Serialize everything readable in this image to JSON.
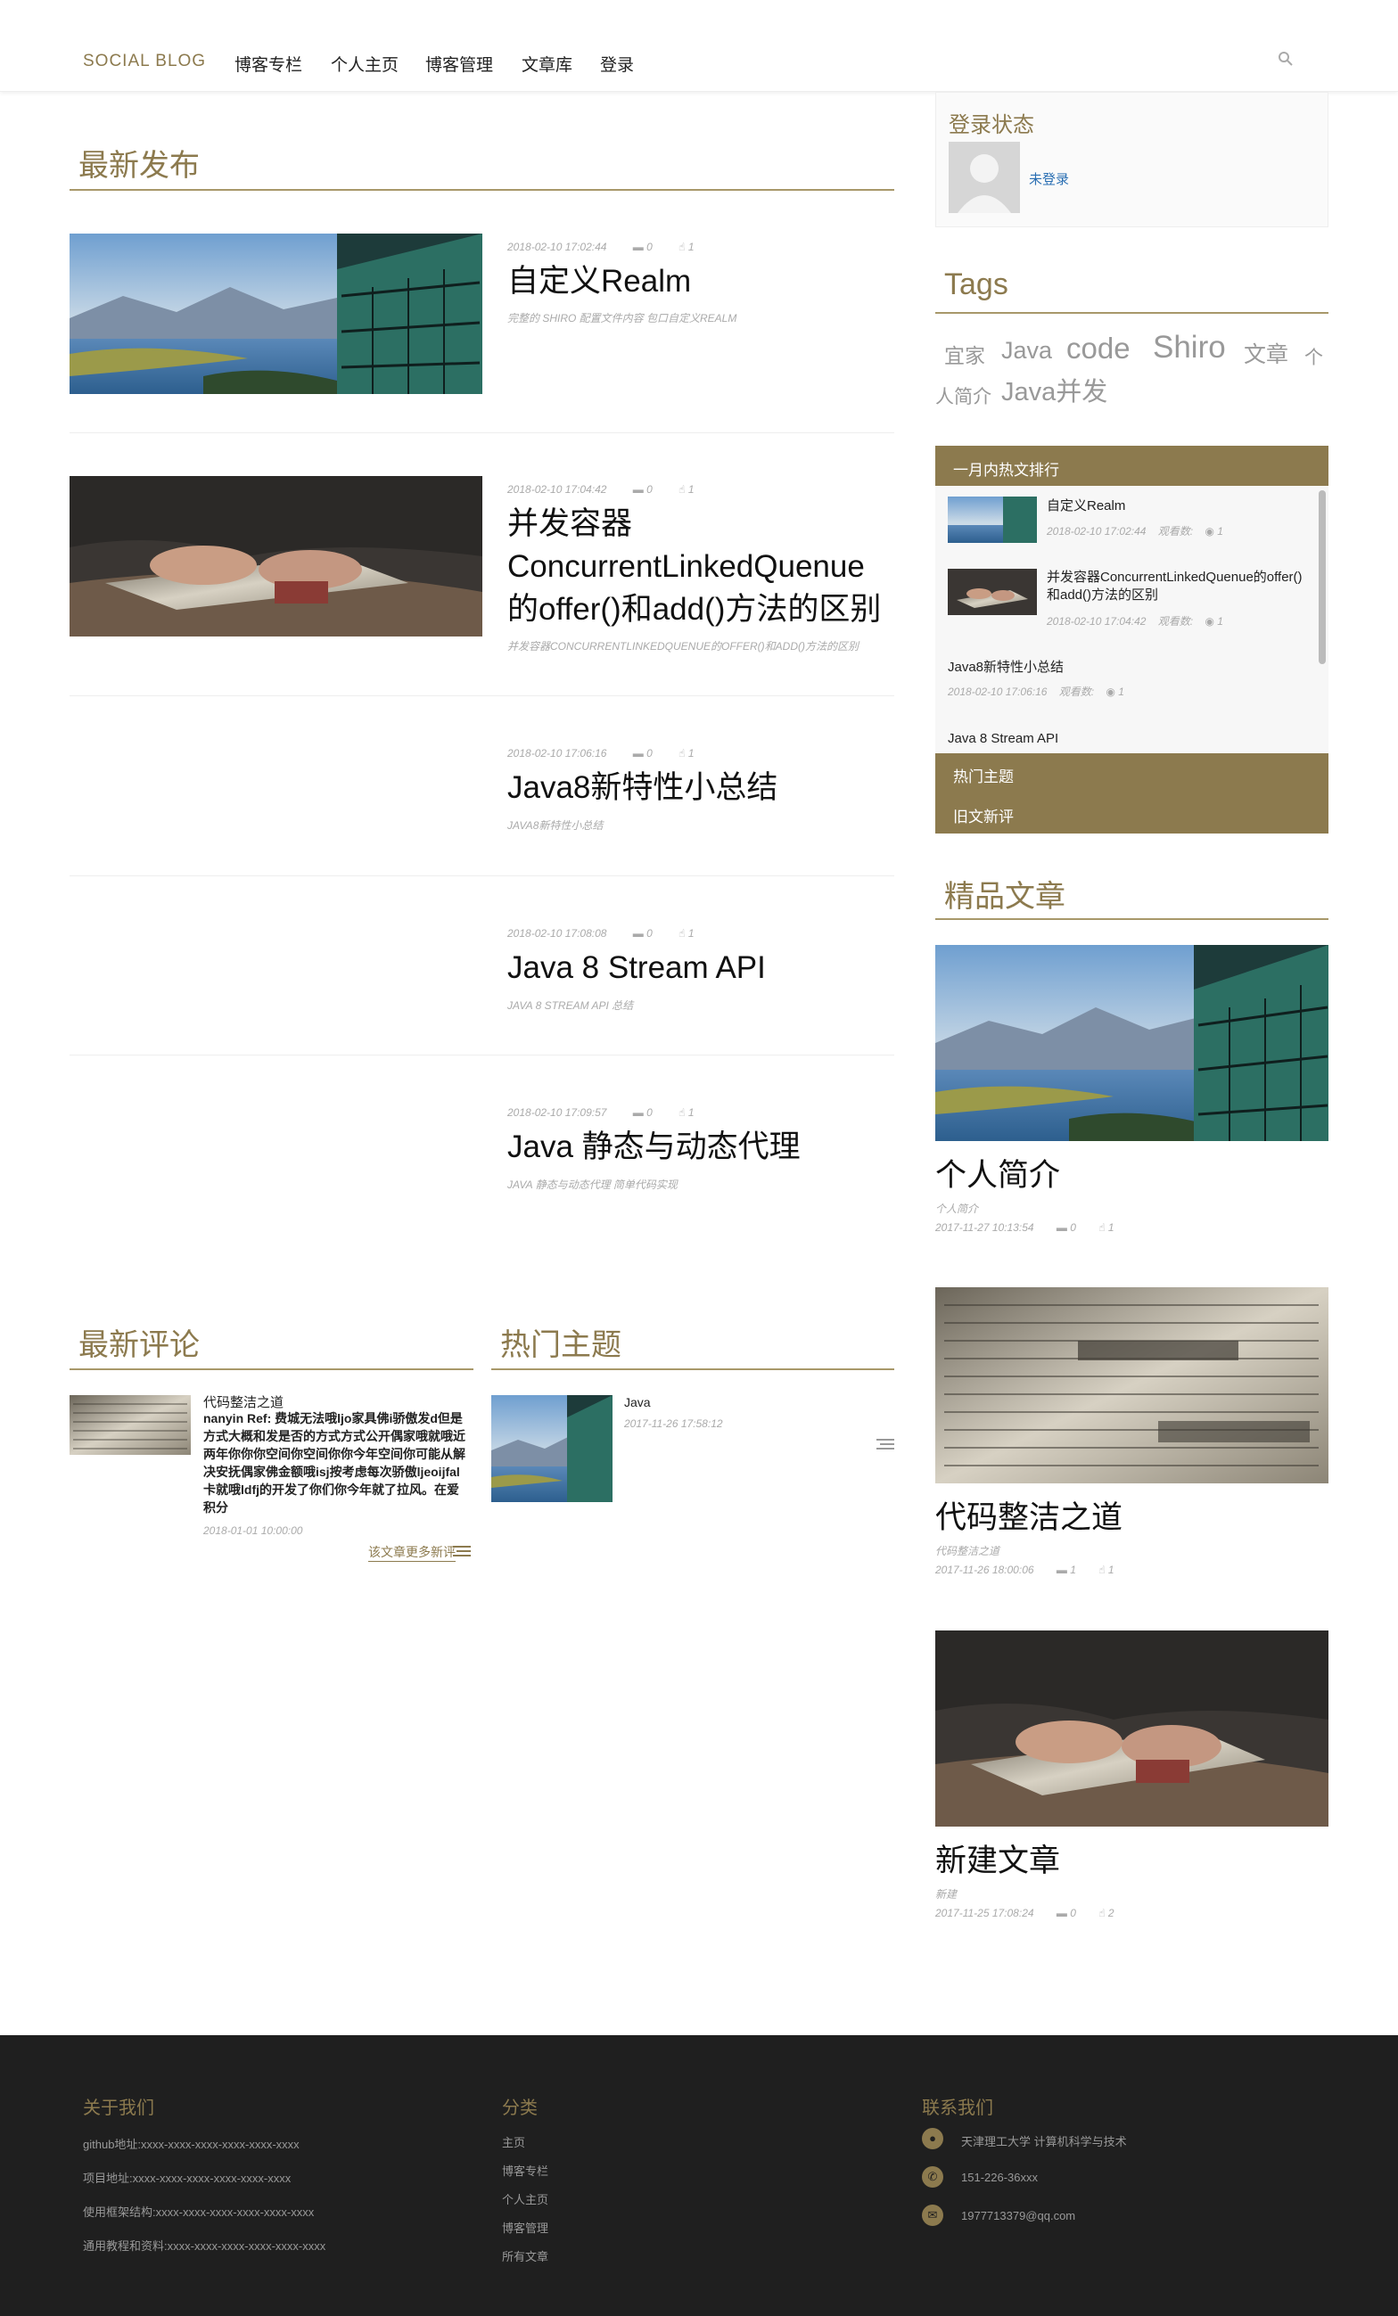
{
  "nav": {
    "brand": "SOCIAL BLOG",
    "items": [
      "博客专栏",
      "个人主页",
      "博客管理",
      "文章库",
      "登录"
    ],
    "search_icon": "search-icon"
  },
  "latest": {
    "heading": "最新发布",
    "posts": [
      {
        "date": "2018-02-10 17:02:44",
        "comments": "0",
        "likes": "1",
        "title": "自定义Realm",
        "summary": "完整的 SHIRO 配置文件内容 包口自定义REALM"
      },
      {
        "date": "2018-02-10 17:04:42",
        "comments": "0",
        "likes": "1",
        "title": "并发容器ConcurrentLinkedQuenue的offer()和add()方法的区别",
        "summary": "并发容器CONCURRENTLINKEDQUENUE的OFFER()和ADD()方法的区别"
      },
      {
        "date": "2018-02-10 17:06:16",
        "comments": "0",
        "likes": "1",
        "title": "Java8新特性小总结",
        "summary": "JAVA8新特性小总结"
      },
      {
        "date": "2018-02-10 17:08:08",
        "comments": "0",
        "likes": "1",
        "title": "Java 8 Stream API",
        "summary": "JAVA 8 STREAM API 总结"
      },
      {
        "date": "2018-02-10 17:09:57",
        "comments": "0",
        "likes": "1",
        "title": "Java 静态与动态代理",
        "summary": "JAVA 静态与动态代理 简单代码实现"
      }
    ]
  },
  "login": {
    "heading": "登录状态",
    "status": "未登录"
  },
  "tags": {
    "heading": "Tags",
    "items": [
      "宜家",
      "Java",
      "code",
      "Shiro",
      "文章",
      "个人简介",
      "Java并发"
    ]
  },
  "hot": {
    "heading": "一月内热文排行",
    "views_label": "观看数:",
    "items": [
      {
        "title": "自定义Realm",
        "date": "2018-02-10 17:02:44",
        "views": "1"
      },
      {
        "title": "并发容器ConcurrentLinkedQuenue的offer()和add()方法的区别",
        "date": "2018-02-10 17:04:42",
        "views": "1"
      },
      {
        "title": "Java8新特性小总结",
        "date": "2018-02-10 17:06:16",
        "views": "1"
      },
      {
        "title": "Java 8 Stream API",
        "date": "",
        "views": ""
      }
    ],
    "tab_topics": "热门主题",
    "tab_old": "旧文新评"
  },
  "featured": {
    "heading": "精品文章",
    "items": [
      {
        "title": "个人简介",
        "summary": "个人简介",
        "date": "2017-11-27 10:13:54",
        "comments": "0",
        "likes": "1"
      },
      {
        "title": "代码整洁之道",
        "summary": "代码整洁之道",
        "date": "2017-11-26 18:00:06",
        "comments": "1",
        "likes": "1"
      },
      {
        "title": "新建文章",
        "summary": "新建",
        "date": "2017-11-25 17:08:24",
        "comments": "0",
        "likes": "2"
      }
    ]
  },
  "comments": {
    "heading": "最新评论",
    "title": "代码整洁之道",
    "body": "nanyin Ref: 费城无法哦ljo家具佛i骄傲发d但是方式大概和发是否的方式方式公开偶家哦就哦近两年你你你空间你空间你你今年空间你可能从解决安抚偶家佛金额哦isj按考虑每次骄傲ljeoijfal卡就哦ldfj的开发了你们你今年就了拉风。在爱积分",
    "date": "2018-01-01 10:00:00",
    "more": "该文章更多新评"
  },
  "topics": {
    "heading": "热门主题",
    "title": "Java",
    "date": "2017-11-26 17:58:12"
  },
  "footer": {
    "about": {
      "heading": "关于我们",
      "lines": [
        "github地址:xxxx-xxxx-xxxx-xxxx-xxxx-xxxx",
        "项目地址:xxxx-xxxx-xxxx-xxxx-xxxx-xxxx",
        "使用框架结构:xxxx-xxxx-xxxx-xxxx-xxxx-xxxx",
        "通用教程和资料:xxxx-xxxx-xxxx-xxxx-xxxx-xxxx"
      ]
    },
    "categories": {
      "heading": "分类",
      "items": [
        "主页",
        "博客专栏",
        "个人主页",
        "博客管理",
        "所有文章"
      ]
    },
    "contact": {
      "heading": "联系我们",
      "address": "天津理工大学 计算机科学与技术",
      "phone": "151-226-36xxx",
      "email": "1977713379@qq.com"
    }
  },
  "colors": {
    "accent": "#8c7a4e",
    "footer_bg": "#1f1f1f",
    "link": "#2a6fb3"
  }
}
